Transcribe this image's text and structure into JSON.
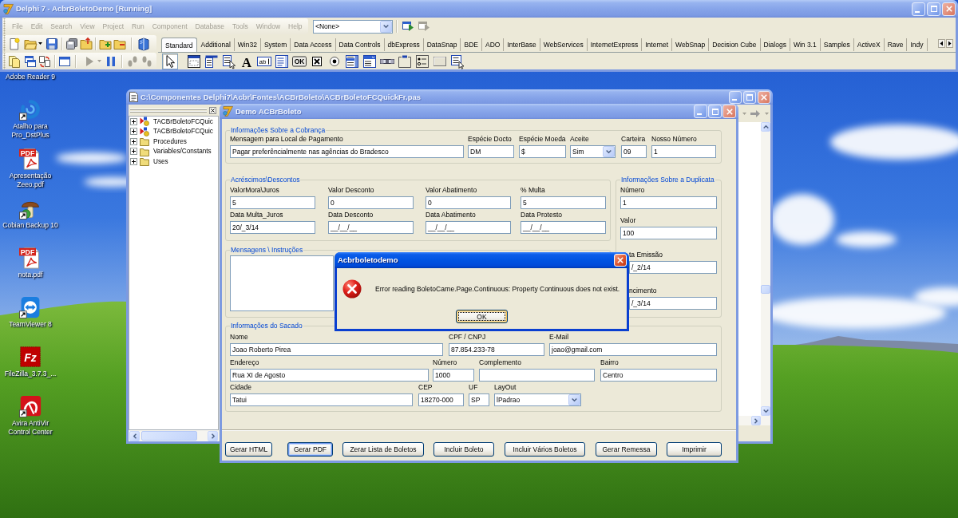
{
  "desktop": {
    "icons": [
      {
        "label": "Adobe Reader 9"
      },
      {
        "label": "Atalho para Pro_DstPlus",
        "shortcut": true
      },
      {
        "label": "Apresentação Zeeo.pdf",
        "shortcut": false,
        "badge": "PDF"
      },
      {
        "label": "Cobian Backup 10",
        "shortcut": true
      },
      {
        "label": "nota.pdf",
        "shortcut": false,
        "badge": "PDF"
      },
      {
        "label": "TeamViewer 8",
        "shortcut": true
      },
      {
        "label": "FileZilla_3.7.3_...",
        "shortcut": false,
        "badge": "Fz"
      },
      {
        "label": "Avira AntiVir Control Center",
        "shortcut": true
      }
    ]
  },
  "ide_window": {
    "title": "Delphi 7 - AcbrBoletoDemo [Running]",
    "active": false,
    "menu": [
      {
        "label": "File",
        "disabled": true
      },
      {
        "label": "Edit",
        "disabled": true
      },
      {
        "label": "Search",
        "disabled": true
      },
      {
        "label": "View",
        "disabled": true
      },
      {
        "label": "Project",
        "disabled": true
      },
      {
        "label": "Run",
        "disabled": true
      },
      {
        "label": "Component",
        "disabled": true
      },
      {
        "label": "Database",
        "disabled": true
      },
      {
        "label": "Tools",
        "disabled": true
      },
      {
        "label": "Window",
        "disabled": true
      },
      {
        "label": "Help",
        "disabled": true
      }
    ],
    "desktop_combo": "<None>",
    "desktop_tools": [
      {
        "disabled": false
      },
      {
        "disabled": true
      }
    ],
    "toolbar_2": [
      {
        "disabled": false
      },
      {
        "disabled": false
      },
      {
        "disabled": false
      },
      {
        "disabled": false
      },
      {
        "disabled": true
      },
      {
        "disabled": false
      },
      {
        "disabled": true
      },
      {
        "disabled": true
      }
    ],
    "palette_tabs": [
      {
        "label": "Standard",
        "selected": true
      },
      {
        "label": "Additional",
        "selected": false
      },
      {
        "label": "Win32",
        "selected": false
      },
      {
        "label": "System",
        "selected": false
      },
      {
        "label": "Data Access",
        "selected": false
      },
      {
        "label": "Data Controls",
        "selected": false
      },
      {
        "label": "dbExpress",
        "selected": false
      },
      {
        "label": "DataSnap",
        "selected": false
      },
      {
        "label": "BDE",
        "selected": false
      },
      {
        "label": "ADO",
        "selected": false
      },
      {
        "label": "InterBase",
        "selected": false
      },
      {
        "label": "WebServices",
        "selected": false
      },
      {
        "label": "InternetExpress",
        "selected": false
      },
      {
        "label": "Internet",
        "selected": false
      },
      {
        "label": "WebSnap",
        "selected": false
      },
      {
        "label": "Decision Cube",
        "selected": false
      },
      {
        "label": "Dialogs",
        "selected": false
      },
      {
        "label": "Win 3.1",
        "selected": false
      },
      {
        "label": "Samples",
        "selected": false
      },
      {
        "label": "ActiveX",
        "selected": false
      },
      {
        "label": "Rave",
        "selected": false
      },
      {
        "label": "Indy",
        "selected": false
      }
    ],
    "palette_items": [
      {
        "selected": true
      },
      {
        "selected": false
      },
      {
        "selected": false
      },
      {
        "selected": false
      },
      {
        "selected": false,
        "glyph": "A"
      },
      {
        "selected": false,
        "glyph": "ab"
      },
      {
        "selected": false
      },
      {
        "selected": false,
        "glyph": "OK"
      },
      {
        "selected": false
      },
      {
        "selected": false
      },
      {
        "selected": false
      },
      {
        "selected": false
      },
      {
        "selected": false
      },
      {
        "selected": false
      },
      {
        "selected": false
      },
      {
        "selected": false
      },
      {
        "selected": false
      }
    ]
  },
  "editor_window": {
    "title": "C:\\Componentes Delphi7\\Acbr\\Fontes\\ACBrBoleto\\ACBrBoletoFCQuickFr.pas",
    "active": false,
    "explorer": [
      {
        "label": "TACBrBoletoFCQuic",
        "kind": "class",
        "expanded": false
      },
      {
        "label": "TACBrBoletoFCQuic",
        "kind": "class",
        "expanded": false
      },
      {
        "label": "Procedures",
        "kind": "folder",
        "expanded": false
      },
      {
        "label": "Variables/Constants",
        "kind": "folder",
        "expanded": false
      },
      {
        "label": "Uses",
        "kind": "folder",
        "expanded": false
      }
    ]
  },
  "demo_window": {
    "title": "Demo ACBrBoleto",
    "active": false,
    "cobranca": {
      "title": "Informações Sobre a Cobrança",
      "fields": [
        {
          "label": "Mensagem para Local de Pagamento",
          "value": "Pagar preferêncialmente nas agências do Bradesco",
          "kind": "edit"
        },
        {
          "label": "Espécie Docto",
          "value": "DM",
          "kind": "edit"
        },
        {
          "label": "Espécie Moeda",
          "value": "$",
          "kind": "edit"
        },
        {
          "label": "Aceite",
          "value": "Sim",
          "kind": "combo"
        },
        {
          "label": "Carteira",
          "value": "09",
          "kind": "edit"
        },
        {
          "label": "Nosso Número",
          "value": "1",
          "kind": "edit"
        }
      ]
    },
    "acrescimos": {
      "title": "Acréscimos\\Descontos",
      "fields": [
        {
          "label": "ValorMora\\Juros",
          "value": "5"
        },
        {
          "label": "Valor Desconto",
          "value": "0"
        },
        {
          "label": "Valor Abatimento",
          "value": "0"
        },
        {
          "label": "% Multa",
          "value": "5"
        },
        {
          "label": "Data Multa_Juros",
          "value": "20/_3/14"
        },
        {
          "label": "Data Desconto",
          "value": "__/__/__"
        },
        {
          "label": "Data Abatimento",
          "value": "__/__/__"
        },
        {
          "label": "Data Protesto",
          "value": "__/__/__"
        }
      ]
    },
    "duplicata": {
      "title": "Informações Sobre a Duplicata",
      "fields": [
        {
          "label": "Número",
          "value": "1",
          "partly_hidden": false
        },
        {
          "label": "Valor",
          "value": "100",
          "partly_hidden": false
        },
        {
          "label": "ta Emissão",
          "value": "/_2/14",
          "partly_hidden": true
        },
        {
          "label": "ncimento",
          "value": "/_3/14",
          "partly_hidden": true
        }
      ]
    },
    "mensagens": {
      "title": "Mensagens \\ Instruções"
    },
    "sacado": {
      "title": "Informações do Sacado",
      "fields": [
        {
          "label": "Nome",
          "value": "Joao Roberto Pirea",
          "kind": "edit"
        },
        {
          "label": "CPF / CNPJ",
          "value": "87.854.233-78",
          "kind": "edit"
        },
        {
          "label": "E-Mail",
          "value": "joao@gmail.com",
          "kind": "edit"
        },
        {
          "label": "Endereço",
          "value": "Rua XI de Agosto",
          "kind": "edit"
        },
        {
          "label": "Número",
          "value": "1000",
          "kind": "edit"
        },
        {
          "label": "Complemento",
          "kind": "edit"
        },
        {
          "label": "Bairro",
          "value": "Centro",
          "kind": "edit"
        },
        {
          "label": "Cidade",
          "value": "Tatui",
          "kind": "edit"
        },
        {
          "label": "CEP",
          "value": "18270-000",
          "kind": "edit"
        },
        {
          "label": "UF",
          "value": "SP",
          "kind": "edit"
        },
        {
          "label": "LayOut",
          "value": "lPadrao",
          "kind": "combo"
        }
      ]
    },
    "buttons": [
      {
        "label": "Gerar HTML",
        "focused": false
      },
      {
        "label": "Gerar PDF",
        "focused": true
      },
      {
        "label": "Zerar Lista de Boletos",
        "focused": false
      },
      {
        "label": "Incluir Boleto",
        "focused": false
      },
      {
        "label": "Incluir Vários Boletos",
        "focused": false
      },
      {
        "label": "Gerar Remessa",
        "focused": false
      },
      {
        "label": "Imprimir",
        "focused": false
      }
    ]
  },
  "dialog": {
    "title": "Acbrboletodemo",
    "active": true,
    "message": "Error reading BoletoCarne.Page.Continuous: Property Continuous does not exist.",
    "button": {
      "label": "OK",
      "focused": true
    }
  }
}
